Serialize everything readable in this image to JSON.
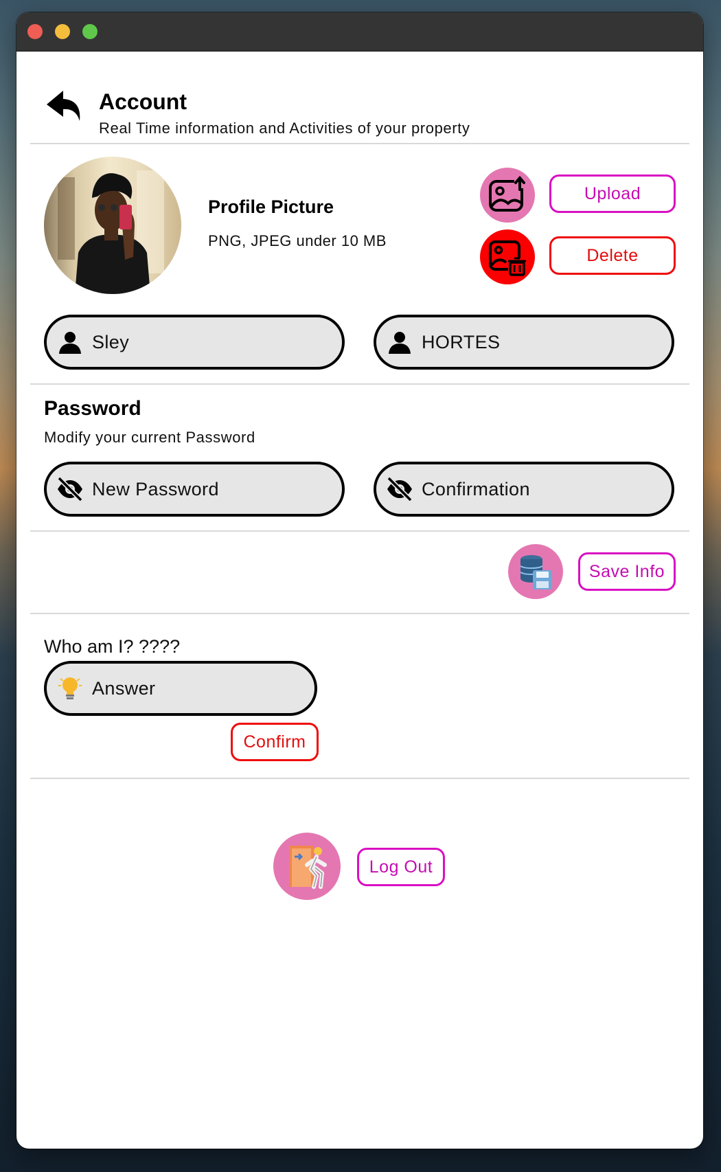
{
  "window": {
    "controls": [
      "close",
      "minimize",
      "maximize"
    ]
  },
  "header": {
    "back_icon": "back-arrow-icon",
    "title": "Account",
    "subtitle": "Real Time information and Activities of your property"
  },
  "profile": {
    "title": "Profile Picture",
    "subtitle": "PNG, JPEG under 10 MB",
    "upload_label": "Upload",
    "delete_label": "Delete",
    "upload_icon": "image-upload-icon",
    "delete_icon": "image-delete-icon"
  },
  "names": {
    "first_name": "Sley",
    "last_name": "HORTES",
    "icon": "user-icon"
  },
  "password": {
    "title": "Password",
    "subtitle": "Modify your current Password",
    "new_placeholder": "New Password",
    "confirm_placeholder": "Confirmation",
    "icon": "eye-slash-icon"
  },
  "save": {
    "label": "Save Info",
    "icon": "database-save-icon"
  },
  "security_question": {
    "question": "Who am I? ????",
    "answer_placeholder": "Answer",
    "confirm_label": "Confirm",
    "icon": "lightbulb-icon"
  },
  "logout": {
    "label": "Log Out",
    "icon": "exit-door-icon"
  },
  "colors": {
    "accent_magenta": "#d90fc2",
    "accent_red": "#ef0b0b",
    "icon_pink": "#e477b1",
    "icon_red": "#fb0000",
    "field_bg": "#e6e6e6"
  }
}
